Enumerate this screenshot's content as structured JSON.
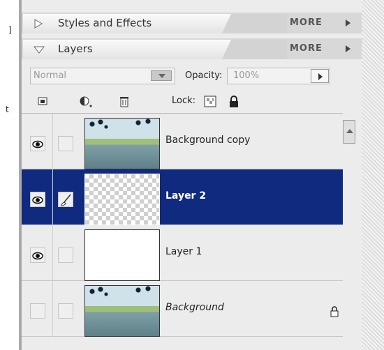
{
  "panels": {
    "styles": {
      "title": "Styles and Effects",
      "more": "MORE"
    },
    "layers": {
      "title": "Layers",
      "more": "MORE"
    }
  },
  "controls": {
    "blend_mode": "Normal",
    "opacity_label": "Opacity:",
    "opacity_value": "100%",
    "lock_label": "Lock:",
    "icons": [
      "new-layer-icon",
      "adjustment-layer-icon",
      "trash-icon",
      "lock-transparency-icon",
      "lock-all-icon"
    ]
  },
  "layers": [
    {
      "name": "Background copy",
      "visible": true,
      "linked": false,
      "selected": false,
      "thumb": "photo",
      "locked": false
    },
    {
      "name": "Layer 2",
      "visible": true,
      "linked": true,
      "selected": true,
      "thumb": "transparent",
      "locked": false
    },
    {
      "name": "Layer 1",
      "visible": true,
      "linked": false,
      "selected": false,
      "thumb": "white",
      "locked": false
    },
    {
      "name": "Background",
      "visible": false,
      "linked": false,
      "selected": false,
      "thumb": "photo",
      "locked": true
    }
  ],
  "colors": {
    "selected_row": "#0f2a7e",
    "panel_bg": "#ececec"
  }
}
